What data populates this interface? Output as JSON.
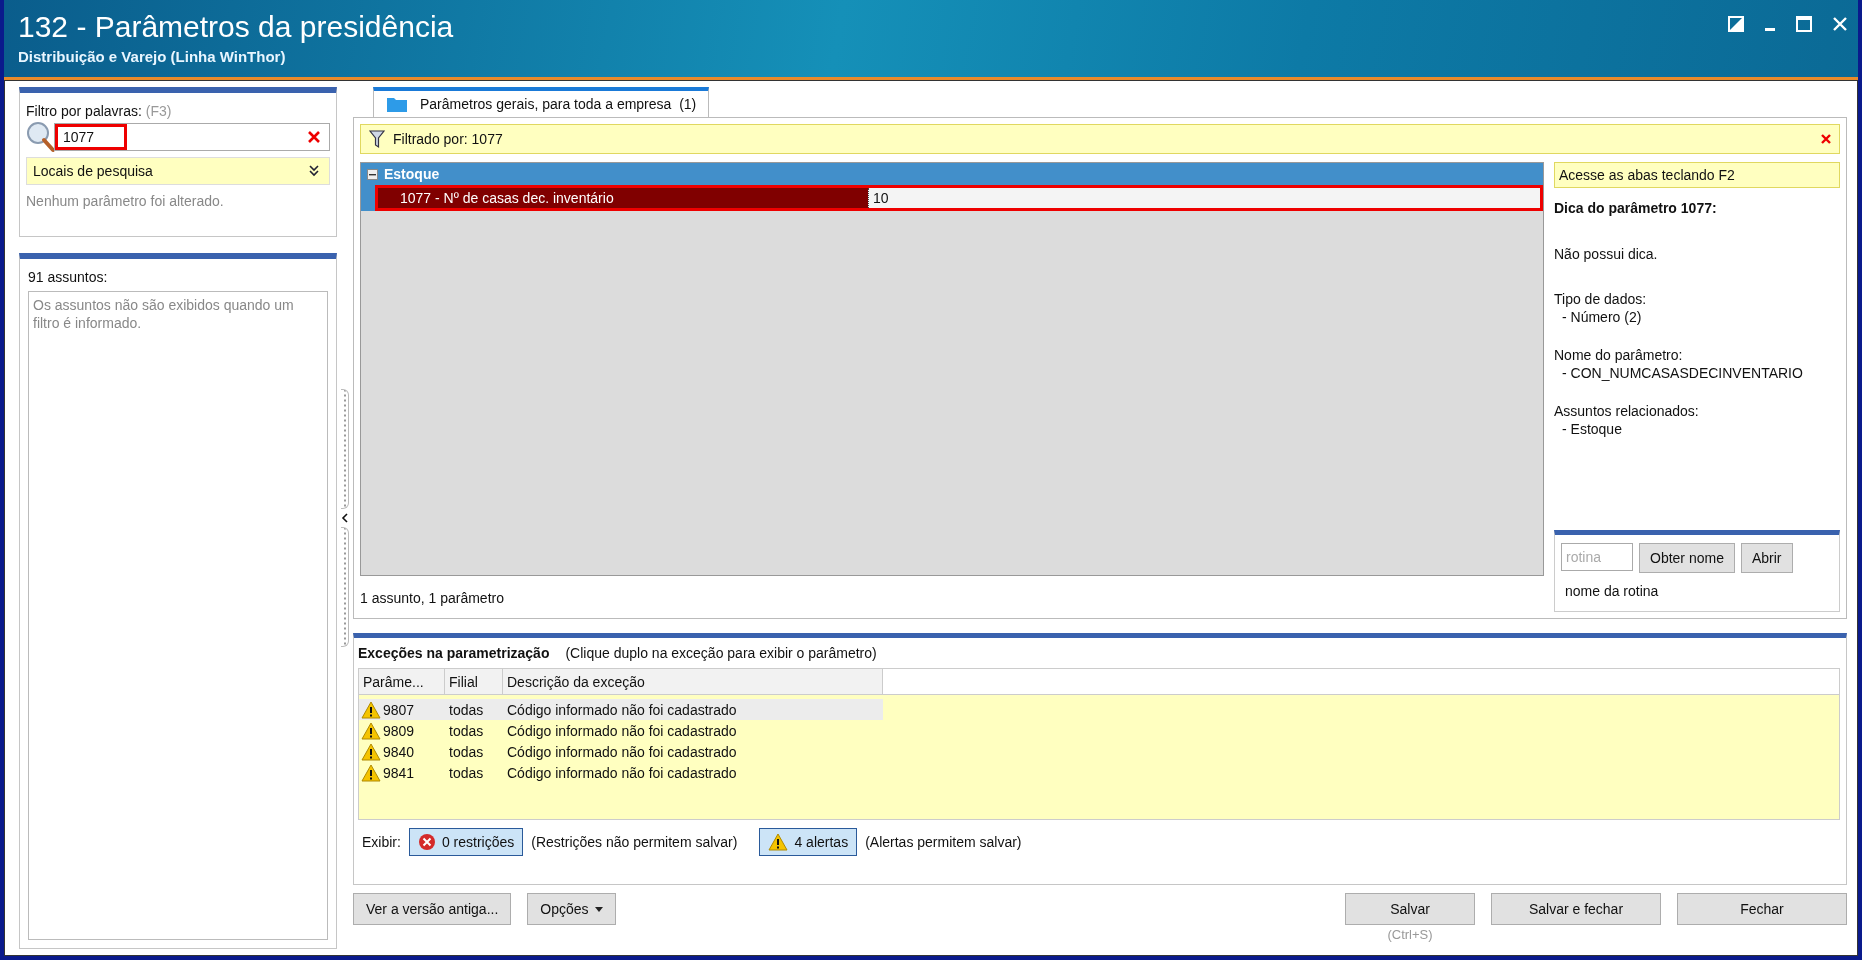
{
  "window": {
    "title": "132 - Parâmetros da presidência",
    "subtitle": "Distribuição e Varejo (Linha WinThor)"
  },
  "filter": {
    "label": "Filtro por palavras:",
    "shortcut": "(F3)",
    "value": "1077",
    "highlighted": true,
    "search_locations": "Locais de pesquisa",
    "status": "Nenhum parâmetro foi alterado."
  },
  "subjects": {
    "count_label": "91 assuntos:",
    "note": "Os assuntos não são exibidos quando um filtro é informado."
  },
  "tabs": [
    {
      "label": "Parâmetros gerais, para toda a empresa",
      "count": "(1)",
      "selected": true
    }
  ],
  "filter_bar": {
    "text": "Filtrado por: 1077"
  },
  "groups": [
    {
      "name": "Estoque",
      "expanded": true,
      "rows": [
        {
          "label": "1077 - Nº de casas dec. inventário",
          "value": "10",
          "selected": true,
          "highlighted": true
        }
      ]
    }
  ],
  "summary": "1 assunto, 1 parâmetro",
  "hint_panel": {
    "banner": "Acesse as abas teclando F2",
    "title": "Dica do parâmetro 1077:",
    "tip": "Não possui dica.",
    "sections": [
      {
        "heading": "Tipo de dados:",
        "value": "- Número (2)"
      },
      {
        "heading": "Nome do parâmetro:",
        "value": "- CON_NUMCASASDECINVENTARIO"
      },
      {
        "heading": "Assuntos relacionados:",
        "value": "- Estoque"
      }
    ]
  },
  "routine": {
    "placeholder": "rotina",
    "buttons": [
      "Obter nome",
      "Abrir"
    ],
    "name_label": "nome da rotina"
  },
  "exceptions": {
    "title": "Exceções na parametrização",
    "hint": "(Clique duplo na exceção para exibir o parâmetro)",
    "columns": [
      "Parâme...",
      "Filial",
      "Descrição da exceção"
    ],
    "rows": [
      {
        "param": "9807",
        "branch": "todas",
        "description": "Código informado não foi cadastrado",
        "selected": true
      },
      {
        "param": "9809",
        "branch": "todas",
        "description": "Código informado não foi cadastrado",
        "selected": false
      },
      {
        "param": "9840",
        "branch": "todas",
        "description": "Código informado não foi cadastrado",
        "selected": false
      },
      {
        "param": "9841",
        "branch": "todas",
        "description": "Código informado não foi cadastrado",
        "selected": false
      }
    ],
    "show_label": "Exibir:",
    "toggles": [
      {
        "kind": "error",
        "label": "0 restrições",
        "note": "(Restrições não permitem salvar)"
      },
      {
        "kind": "warning",
        "label": "4 alertas",
        "note": "(Alertas permitem salvar)"
      }
    ]
  },
  "footer": {
    "left_buttons": [
      {
        "label": "Ver a versão antiga...",
        "dropdown": false
      },
      {
        "label": "Opções",
        "dropdown": true
      }
    ],
    "right_buttons": [
      {
        "label": "Salvar",
        "shortcut": "(Ctrl+S)"
      },
      {
        "label": "Salvar e fechar"
      },
      {
        "label": "Fechar"
      }
    ]
  }
}
